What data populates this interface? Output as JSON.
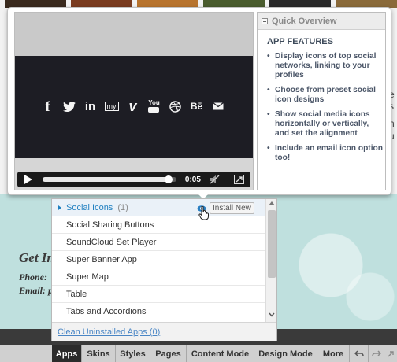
{
  "background_site": {
    "heading": "Get In",
    "phone_label": "Phone:",
    "email_label": "Email: p",
    "right_fragments": [
      "e",
      "s",
      "n",
      "u"
    ]
  },
  "video": {
    "social_icons": [
      "facebook-icon",
      "twitter-icon",
      "linkedin-icon",
      "myspace-icon",
      "vimeo-icon",
      "youtube-icon",
      "dribbble-icon",
      "behance-icon",
      "email-icon"
    ],
    "myspace_text": "my",
    "youtube_text": "You",
    "behance_text": "Bē",
    "linkedin_text": "in",
    "vimeo_text": "v",
    "facebook_text": "f",
    "time": "0:05",
    "progress": 0.95
  },
  "overview": {
    "title": "Quick Overview",
    "features_heading": "APP FEATURES",
    "features": [
      "Display icons of top social networks, linking to your profiles",
      "Choose from preset social icon designs",
      "Show social media icons horizontally or vertically, and set the alignment",
      "Include an email icon option too!"
    ]
  },
  "app_list": {
    "selected": {
      "name": "Social Icons",
      "count": "(1)",
      "install_label": "Install New"
    },
    "items": [
      "Social Sharing Buttons",
      "SoundCloud Set Player",
      "Super Banner App",
      "Super Map",
      "Table",
      "Tabs and Accordions"
    ],
    "clean_link": "Clean Uninstalled Apps (0)"
  },
  "tabbar": {
    "tabs": [
      "Apps",
      "Skins",
      "Styles",
      "Pages",
      "Content Mode",
      "Design Mode",
      "More"
    ],
    "active": "Apps"
  },
  "colors": {
    "accent_blue": "#1f7fc0",
    "link_blue": "#4a86c5",
    "video_dark": "#1d1d24",
    "teal_bg": "#bfe0de"
  }
}
